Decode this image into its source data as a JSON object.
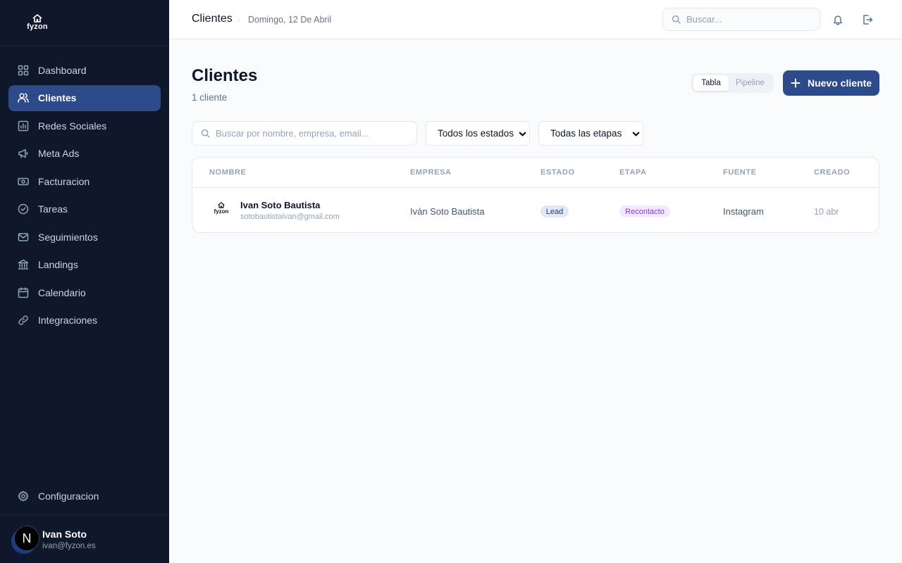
{
  "app": {
    "logo_text": "fyzon"
  },
  "sidebar": {
    "items": [
      {
        "label": "Dashboard",
        "icon": "grid-icon",
        "active": false
      },
      {
        "label": "Clientes",
        "icon": "users-icon",
        "active": true
      },
      {
        "label": "Redes Sociales",
        "icon": "bar-chart-icon",
        "active": false
      },
      {
        "label": "Meta Ads",
        "icon": "megaphone-icon",
        "active": false
      },
      {
        "label": "Facturacion",
        "icon": "banknote-icon",
        "active": false
      },
      {
        "label": "Tareas",
        "icon": "check-circle-icon",
        "active": false
      },
      {
        "label": "Seguimientos",
        "icon": "mail-icon",
        "active": false
      },
      {
        "label": "Landings",
        "icon": "landmark-icon",
        "active": false
      },
      {
        "label": "Calendario",
        "icon": "calendar-icon",
        "active": false
      },
      {
        "label": "Integraciones",
        "icon": "link-icon",
        "active": false
      }
    ],
    "config_label": "Configuracion",
    "user": {
      "initial": "N",
      "name": "Ivan Soto",
      "email": "ivan@fyzon.es"
    }
  },
  "topbar": {
    "title": "Clientes",
    "separator": "·",
    "date": "Domingo, 12 De Abril",
    "search_placeholder": "Buscar..."
  },
  "main": {
    "title": "Clientes",
    "count": "1 cliente",
    "view_toggle": [
      "Tabla",
      "Pipeline"
    ],
    "new_button": "Nuevo cliente",
    "filter_search_placeholder": "Buscar por nombre, empresa, email...",
    "status_select": "Todos los estados",
    "stage_select": "Todas las etapas"
  },
  "table": {
    "columns": [
      "NOMBRE",
      "EMPRESA",
      "ESTADO",
      "ETAPA",
      "FUENTE",
      "CREADO"
    ],
    "rows": [
      {
        "avatar_text": "fyzon",
        "name": "Ivan Soto Bautista",
        "email": "sotobautistaivan@gmail.com",
        "company": "Iván Soto Bautista",
        "status": "Lead",
        "stage": "Recontacto",
        "source": "Instagram",
        "created": "10 abr"
      }
    ]
  },
  "colors": {
    "sidebar_bg": "#0f172a",
    "accent": "#2d4a8a",
    "status_badge_bg": "#e0e8f5",
    "stage_badge_bg": "#f3e8ff",
    "stage_badge_text": "#7e3fc7"
  }
}
